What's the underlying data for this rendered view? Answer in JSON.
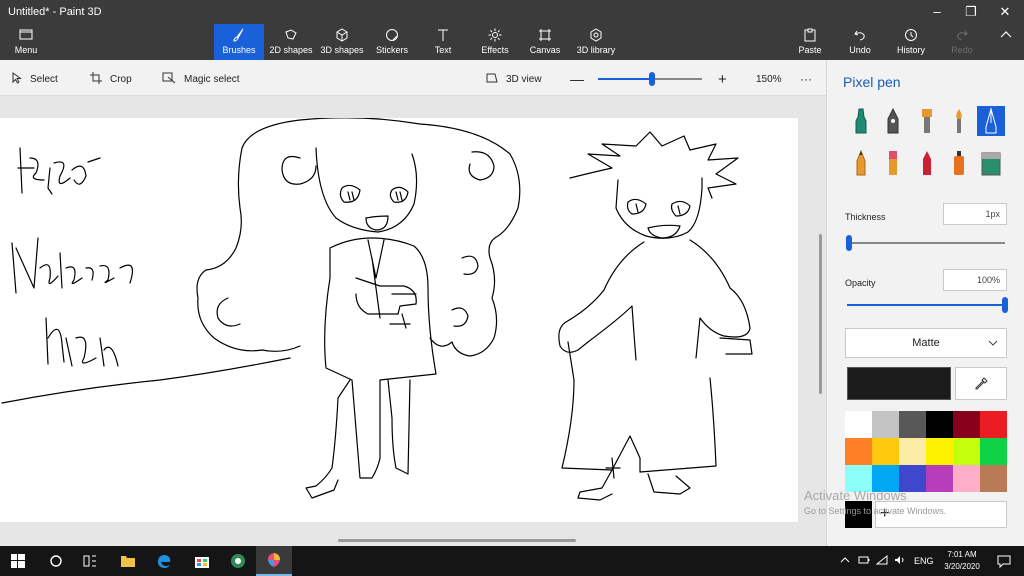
{
  "window": {
    "title": "Untitled* - Paint 3D",
    "controls": {
      "minimize": "–",
      "maximize": "❐",
      "close": "✕"
    }
  },
  "ribbon": {
    "menu_label": "Menu",
    "tabs": [
      {
        "label": "Brushes",
        "icon": "brush-icon",
        "selected": true
      },
      {
        "label": "2D shapes",
        "icon": "shapes-2d-icon"
      },
      {
        "label": "3D shapes",
        "icon": "cube-icon"
      },
      {
        "label": "Stickers",
        "icon": "sticker-icon"
      },
      {
        "label": "Text",
        "icon": "text-icon"
      },
      {
        "label": "Effects",
        "icon": "sun-icon"
      },
      {
        "label": "Canvas",
        "icon": "canvas-icon"
      },
      {
        "label": "3D library",
        "icon": "library-icon"
      }
    ],
    "paste_label": "Paste",
    "undo_label": "Undo",
    "history_label": "History",
    "redo_label": "Redo"
  },
  "toolbar": {
    "select_label": "Select",
    "crop_label": "Crop",
    "magic_select_label": "Magic select",
    "view3d_label": "3D view",
    "zoom_minus": "—",
    "zoom_plus": "+",
    "zoom_level": "150%",
    "zoom_fraction": 0.52,
    "more": "···"
  },
  "panel": {
    "title": "Pixel pen",
    "brushes": [
      {
        "name": "marker",
        "color": "#1e8a72"
      },
      {
        "name": "calligraphy-pen",
        "color": "#555555"
      },
      {
        "name": "oil-brush",
        "color": "#e69a2e"
      },
      {
        "name": "watercolor",
        "color": "#e69a2e"
      },
      {
        "name": "pixel-pen",
        "color": "#ffffff",
        "selected": true
      },
      {
        "name": "pencil",
        "color": "#e69a2e"
      },
      {
        "name": "eraser",
        "color": "#e0506e"
      },
      {
        "name": "crayon",
        "color": "#cc2233"
      },
      {
        "name": "spray-can",
        "color": "#e8711e"
      },
      {
        "name": "fill",
        "color": "#2c8f6c"
      }
    ],
    "thickness_label": "Thickness",
    "thickness_value": "1px",
    "thickness_fraction": 0.01,
    "opacity_label": "Opacity",
    "opacity_value": "100%",
    "opacity_fraction": 1.0,
    "finish_value": "Matte",
    "current_color": "#1b1b1b",
    "palette": [
      "#ffffff",
      "#c3c3c3",
      "#585858",
      "#000000",
      "#88001b",
      "#ec1c24",
      "#ff7f27",
      "#ffc90e",
      "#fdeca6",
      "#fff200",
      "#c4ff0e",
      "#0ed145",
      "#8cfffb",
      "#00a8f3",
      "#3f48cc",
      "#b83dba",
      "#ffaec8",
      "#b97a56"
    ],
    "custom_color": "#000000",
    "add_color": "+"
  },
  "canvas": {
    "handwriting": "Hey dI 8T"
  },
  "activation": {
    "line1": "Activate Windows",
    "line2": "Go to Settings to activate Windows."
  },
  "taskbar": {
    "language": "ENG",
    "time": "7:01 AM",
    "date": "3/20/2020"
  }
}
